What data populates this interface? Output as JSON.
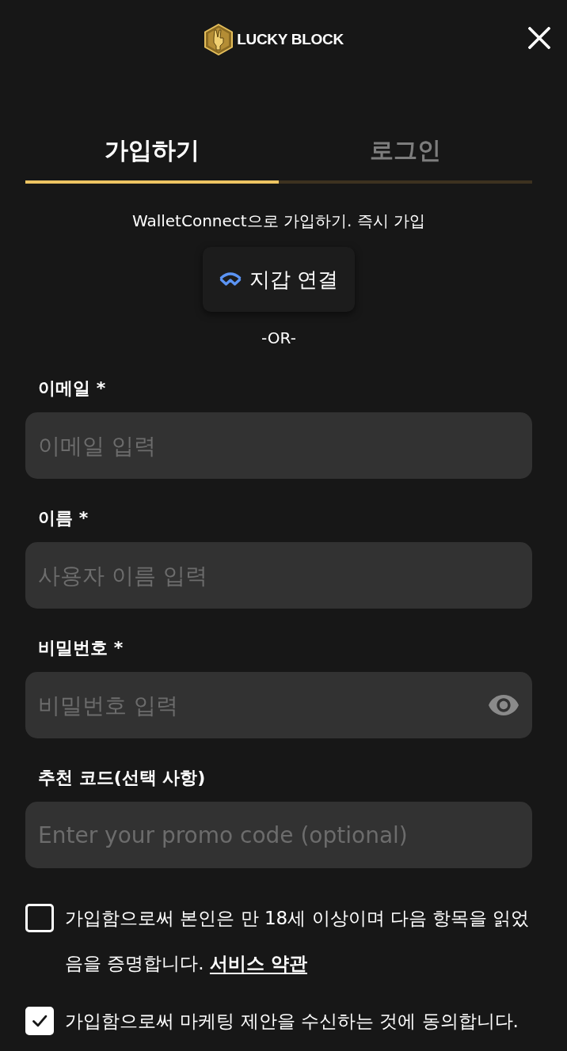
{
  "header": {
    "logo_text": "LUCKY BLOCK"
  },
  "tabs": [
    {
      "label": "가입하기",
      "selected": true
    },
    {
      "label": "로그인",
      "selected": false
    }
  ],
  "wallet": {
    "prompt": "WalletConnect으로 가입하기. 즉시 가입",
    "button": "지갑 연결"
  },
  "divider_text": "-OR-",
  "fields": [
    {
      "kind": "text",
      "label": "이메일 *",
      "placeholder": "이메일 입력"
    },
    {
      "kind": "text",
      "label": "이름 *",
      "placeholder": "사용자 이름 입력"
    },
    {
      "kind": "password",
      "label": "비밀번호 *",
      "placeholder": "비밀번호 입력"
    },
    {
      "kind": "text",
      "label": "추천 코드(선택 사항)",
      "placeholder": "Enter your promo code (optional)"
    }
  ],
  "consents": [
    {
      "text": "가입함으로써 본인은 만 18세 이상이며 다음 항목을 읽었음을 증명합니다.",
      "link": "서비스 약관",
      "checked": false
    },
    {
      "text": "가입함으로써 마케팅 제안을 수신하는 것에 동의합니다.",
      "checked": true
    }
  ]
}
